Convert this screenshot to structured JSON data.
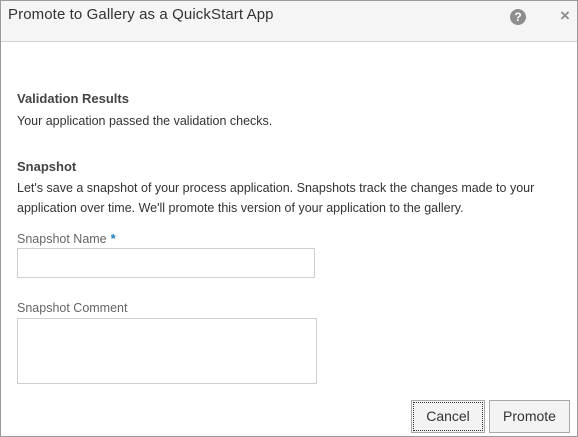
{
  "dialog": {
    "title": "Promote to Gallery as a QuickStart App",
    "help_icon_glyph": "?",
    "close_icon_glyph": "×"
  },
  "validation": {
    "heading": "Validation Results",
    "message": "Your application passed the validation checks."
  },
  "snapshot": {
    "heading": "Snapshot",
    "description_line1": "Let's save a snapshot of your process application. Snapshots track the changes made to your",
    "description_line2": "application over time. We'll promote this version of your application to the gallery.",
    "name_label": "Snapshot Name",
    "name_required_marker": "*",
    "name_value": "",
    "comment_label": "Snapshot Comment",
    "comment_value": ""
  },
  "buttons": {
    "cancel_label": "Cancel",
    "promote_label": "Promote"
  }
}
